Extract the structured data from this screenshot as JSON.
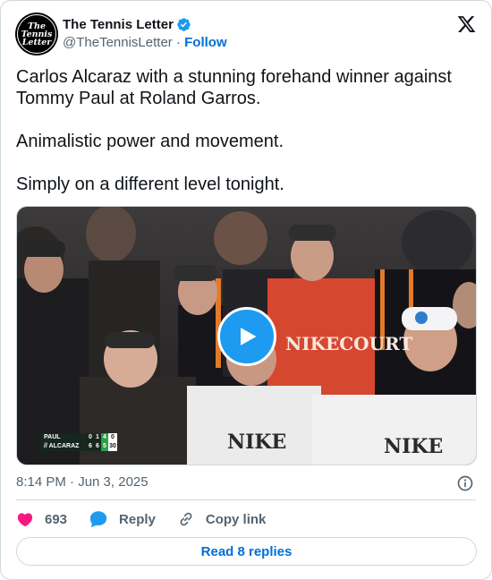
{
  "author": {
    "display_name": "The Tennis Letter",
    "handle": "@TheTennisLetter",
    "separator": "·",
    "follow_label": "Follow",
    "avatar_lines": [
      "The",
      "Tennis",
      "Letter"
    ]
  },
  "tweet": {
    "text": "Carlos Alcaraz with a stunning forehand winner against Tommy Paul at Roland Garros.\n\nAnimalistic power and movement.\n\nSimply on a different level tonight.",
    "timestamp": "8:14 PM · Jun 3, 2025"
  },
  "media": {
    "type": "video",
    "scoreboard": [
      {
        "player": "PAUL",
        "sets": [
          "0",
          "1",
          "4"
        ],
        "point": "0"
      },
      {
        "player": "// ALCARAZ",
        "sets": [
          "6",
          "6",
          "5"
        ],
        "point": "30"
      }
    ]
  },
  "actions": {
    "like_count": "693",
    "reply_label": "Reply",
    "copy_link_label": "Copy link"
  },
  "replies_button": "Read 8 replies",
  "colors": {
    "accent": "#1d9bf0",
    "link": "#006fd6",
    "like": "#f91880",
    "muted": "#536471",
    "border": "#cfd9de"
  },
  "icons": [
    "verified-badge-icon",
    "x-logo-icon",
    "play-icon",
    "info-icon",
    "heart-icon",
    "reply-bubble-icon",
    "link-icon"
  ]
}
